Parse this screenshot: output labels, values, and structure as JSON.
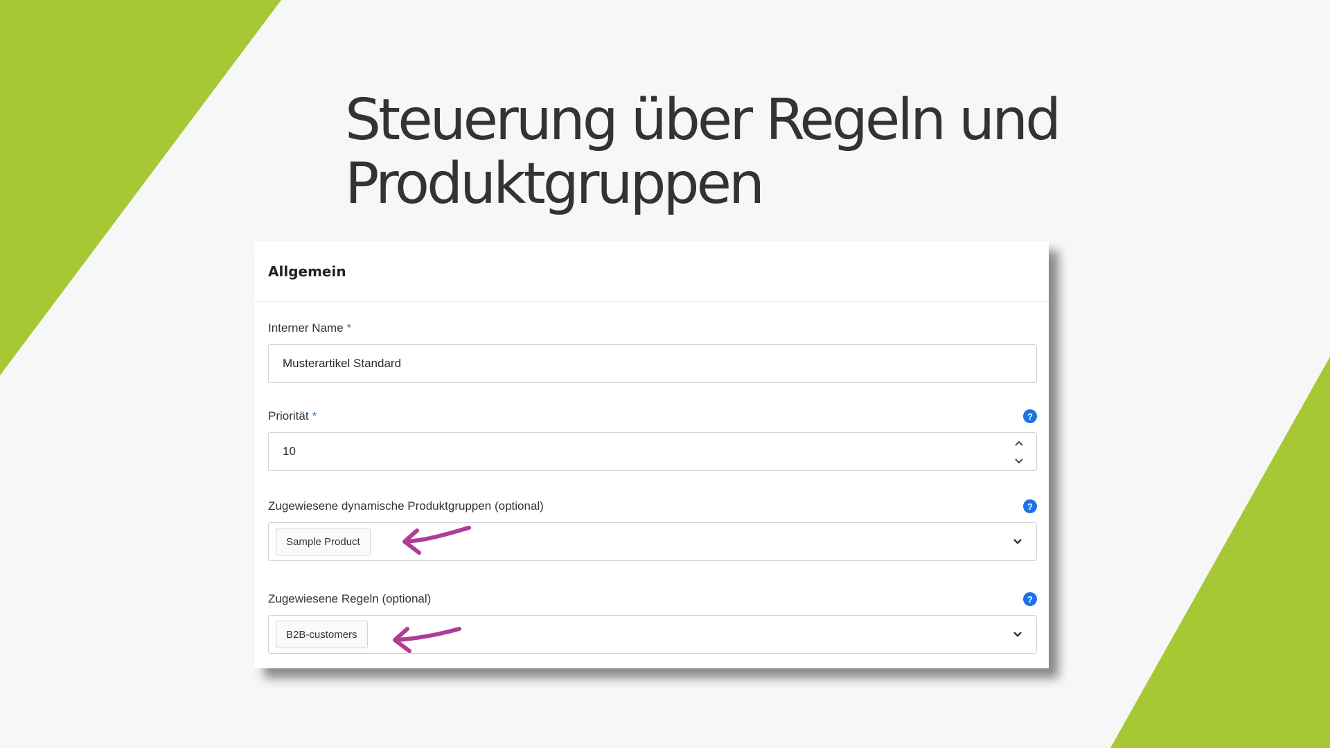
{
  "slide": {
    "title_line1": "Steuerung über Regeln und",
    "title_line2": "Produktgruppen"
  },
  "colors": {
    "accent_green": "#a6c835",
    "arrow_magenta": "#b03c96",
    "help_blue": "#1a73e8"
  },
  "panel": {
    "heading": "Allgemein",
    "internal_name": {
      "label": "Interner Name",
      "required": "*",
      "value": "Musterartikel Standard"
    },
    "priority": {
      "label": "Priorität",
      "required": "*",
      "value": "10",
      "help": "?"
    },
    "product_groups": {
      "label": "Zugewiesene dynamische Produktgruppen (optional)",
      "tag": "Sample Product",
      "help": "?"
    },
    "rules": {
      "label": "Zugewiesene Regeln (optional)",
      "tag": "B2B-customers",
      "help": "?"
    }
  }
}
